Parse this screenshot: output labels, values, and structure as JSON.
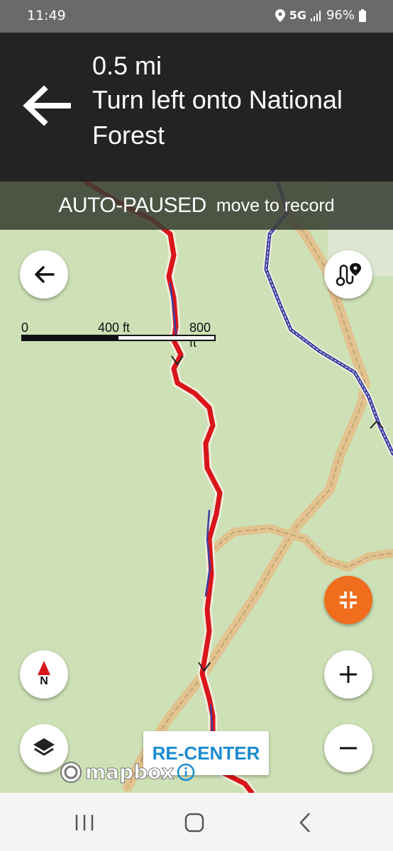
{
  "status_bar": {
    "time": "11:49",
    "network": "5G",
    "battery": "96%",
    "icons": [
      "location-icon",
      "signal-icon",
      "battery-icon"
    ]
  },
  "navigation": {
    "distance": "0.5 mi",
    "instruction": "Turn left onto National Forest",
    "maneuver_icon": "turn-left-arrow-icon"
  },
  "banner": {
    "title": "AUTO-PAUSED",
    "subtitle": "move to record"
  },
  "map": {
    "scale_labels": [
      "0",
      "400 ft",
      "800 ft"
    ],
    "compass_label": "N",
    "attribution": "mapbox",
    "recenter_label": "RE-CENTER"
  },
  "colors": {
    "route": "#d9151b",
    "trail": "#3b3f9f",
    "road": "#e2c28e",
    "map_bg": "#cde0b6",
    "fab_accent": "#f06d1e",
    "recenter_text": "#1b8bd1"
  }
}
